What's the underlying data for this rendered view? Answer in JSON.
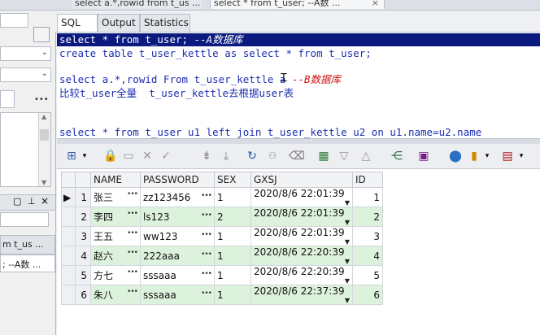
{
  "doc_tabs": [
    {
      "label": "select a.*,rowid from t_us ...",
      "close": "×"
    },
    {
      "label": "select * from t_user; --A数 ...",
      "close": "×"
    }
  ],
  "sub_tabs": [
    "SQL",
    "Output",
    "Statistics"
  ],
  "left_panel": {
    "item1": "m t_us ...",
    "item2": "; --A数 ..."
  },
  "editor": {
    "lines": [
      {
        "code": "select * from t_user; ",
        "comment": "--A数据库"
      },
      {
        "code": "create table t_user_kettle as select * from t_user;",
        "comment": ""
      },
      {
        "code": "",
        "comment": ""
      },
      {
        "code": "select a.*,rowid From t_user_kettle a ",
        "comment": "--B数据库"
      },
      {
        "code": "比较t_user全量  t_user_kettle去根据user表",
        "comment": ""
      },
      {
        "code": "",
        "comment": ""
      },
      {
        "code": "",
        "comment": ""
      },
      {
        "code": "select * from t_user u1 left join t_user_kettle u2 on u1.name=u2.name",
        "comment": ""
      }
    ]
  },
  "grid": {
    "columns": [
      "NAME",
      "PASSWORD",
      "SEX",
      "GXSJ",
      "ID"
    ],
    "rows": [
      {
        "num": "1",
        "name": "张三",
        "password": "zz123456",
        "sex": "1",
        "gxsj": "2020/8/6 22:01:39",
        "id": "1"
      },
      {
        "num": "2",
        "name": "李四",
        "password": "ls123",
        "sex": "2",
        "gxsj": "2020/8/6 22:01:39",
        "id": "2"
      },
      {
        "num": "3",
        "name": "王五",
        "password": "ww123",
        "sex": "1",
        "gxsj": "2020/8/6 22:01:39",
        "id": "3"
      },
      {
        "num": "4",
        "name": "赵六",
        "password": "222aaa",
        "sex": "1",
        "gxsj": "2020/8/6 22:20:39",
        "id": "4"
      },
      {
        "num": "5",
        "name": "方七",
        "password": "sssaaa",
        "sex": "1",
        "gxsj": "2020/8/6 22:20:39",
        "id": "5"
      },
      {
        "num": "6",
        "name": "朱八",
        "password": "sssaaa",
        "sex": "1",
        "gxsj": "2020/8/6 22:37:39",
        "id": "6"
      }
    ]
  },
  "toolbar_icons": [
    "query-builder-icon",
    "lock-icon",
    "add-record-icon",
    "delete-record-icon",
    "post-changes-icon",
    "next-record-icon",
    "last-record-icon",
    "refresh-icon",
    "find-icon",
    "clear-icon",
    "export-icon",
    "filter-down-icon",
    "filter-up-icon",
    "tree-icon",
    "save-icon",
    "connect-icon",
    "chart-icon",
    "grid-view-icon"
  ],
  "colors": {
    "selection": "#0b1a7f",
    "keyword": "#1c2fb0",
    "comment": "#d01010",
    "even_row": "#ddf2dd"
  }
}
